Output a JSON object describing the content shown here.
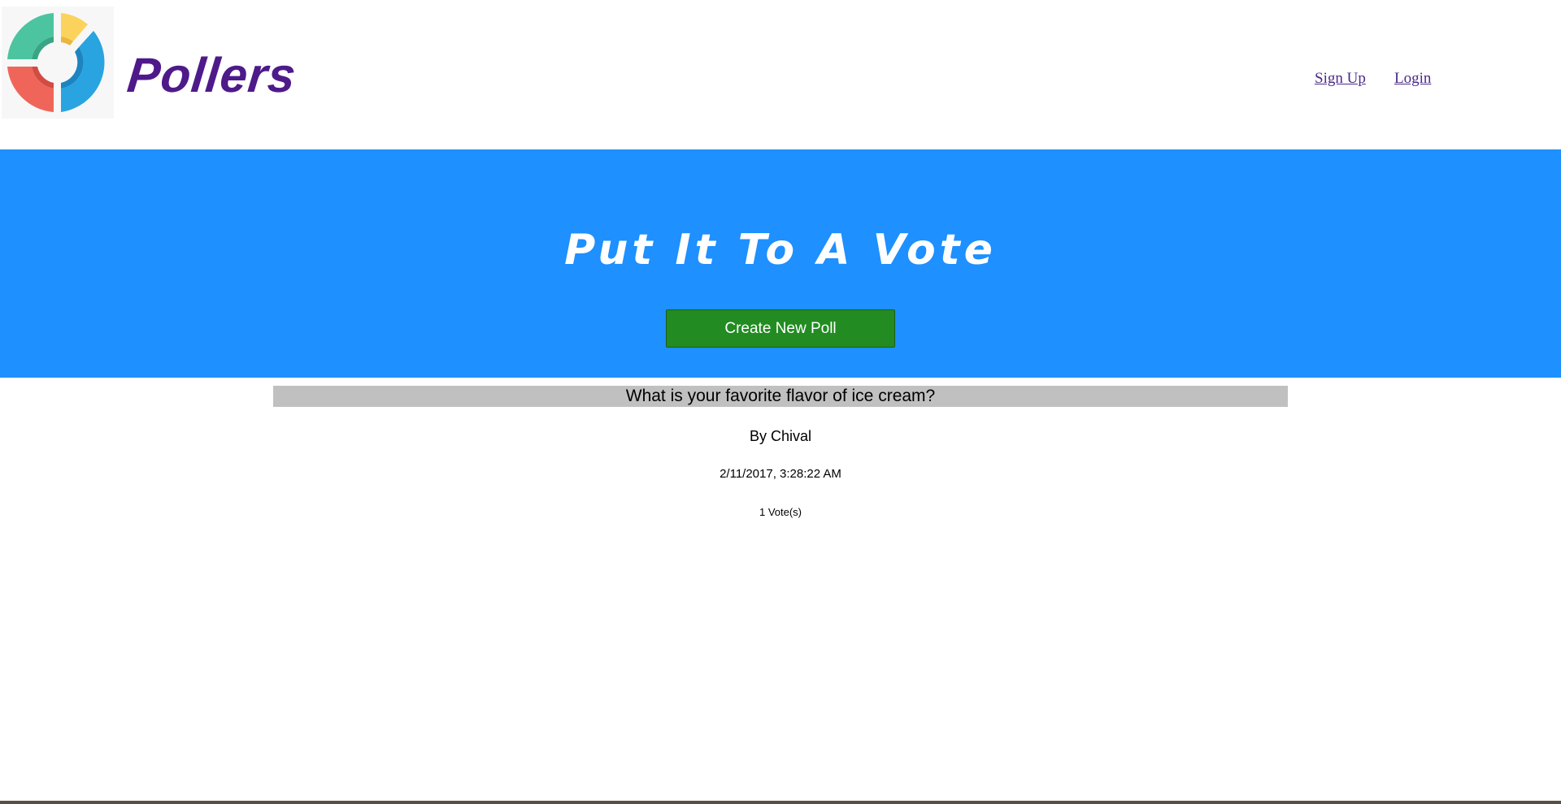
{
  "brand": {
    "name": "Pollers",
    "logo_icon": "donut-chart-logo-icon",
    "color": "#4e1a8a"
  },
  "nav": {
    "signup_label": "Sign Up",
    "login_label": "Login"
  },
  "hero": {
    "title": "Put It To A Vote",
    "create_button_label": "Create New Poll",
    "background_color": "#1e90ff",
    "button_color": "#228b22"
  },
  "polls": [
    {
      "question": "What is your favorite flavor of ice cream?",
      "author": "By Chival",
      "date": "2/11/2017, 3:28:22 AM",
      "votes": "1 Vote(s)"
    }
  ]
}
